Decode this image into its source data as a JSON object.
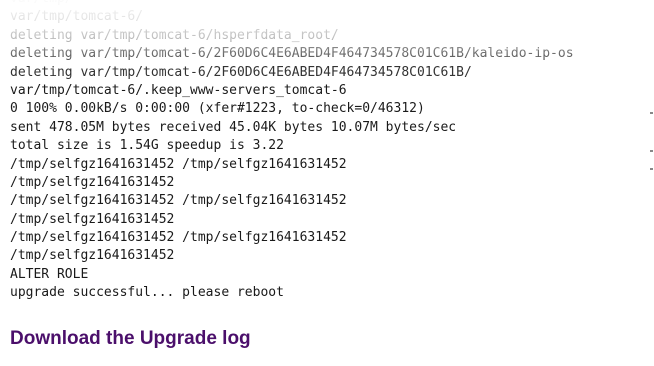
{
  "console": {
    "lines": [
      "var/tmp/",
      "var/tmp/tomcat-6/",
      "deleting var/tmp/tomcat-6/hsperfdata_root/",
      "deleting var/tmp/tomcat-6/2F60D6C4E6ABED4F464734578C01C61B/kaleido-ip-os",
      "deleting var/tmp/tomcat-6/2F60D6C4E6ABED4F464734578C01C61B/",
      "var/tmp/tomcat-6/.keep_www-servers_tomcat-6",
      "0 100% 0.00kB/s 0:00:00 (xfer#1223, to-check=0/46312)",
      "sent 478.05M bytes received 45.04K bytes 10.07M bytes/sec",
      "total size is 1.54G speedup is 3.22",
      "/tmp/selfgz1641631452 /tmp/selfgz1641631452",
      "/tmp/selfgz1641631452",
      "/tmp/selfgz1641631452 /tmp/selfgz1641631452",
      "/tmp/selfgz1641631452",
      "/tmp/selfgz1641631452 /tmp/selfgz1641631452",
      "/tmp/selfgz1641631452",
      "ALTER ROLE",
      "upgrade successful... please reboot"
    ]
  },
  "download_link": {
    "label": "Download the Upgrade log"
  },
  "colors": {
    "text": "#1a1a1a",
    "faded_text": "#9a9a9a",
    "link": "#4b0f6b"
  }
}
